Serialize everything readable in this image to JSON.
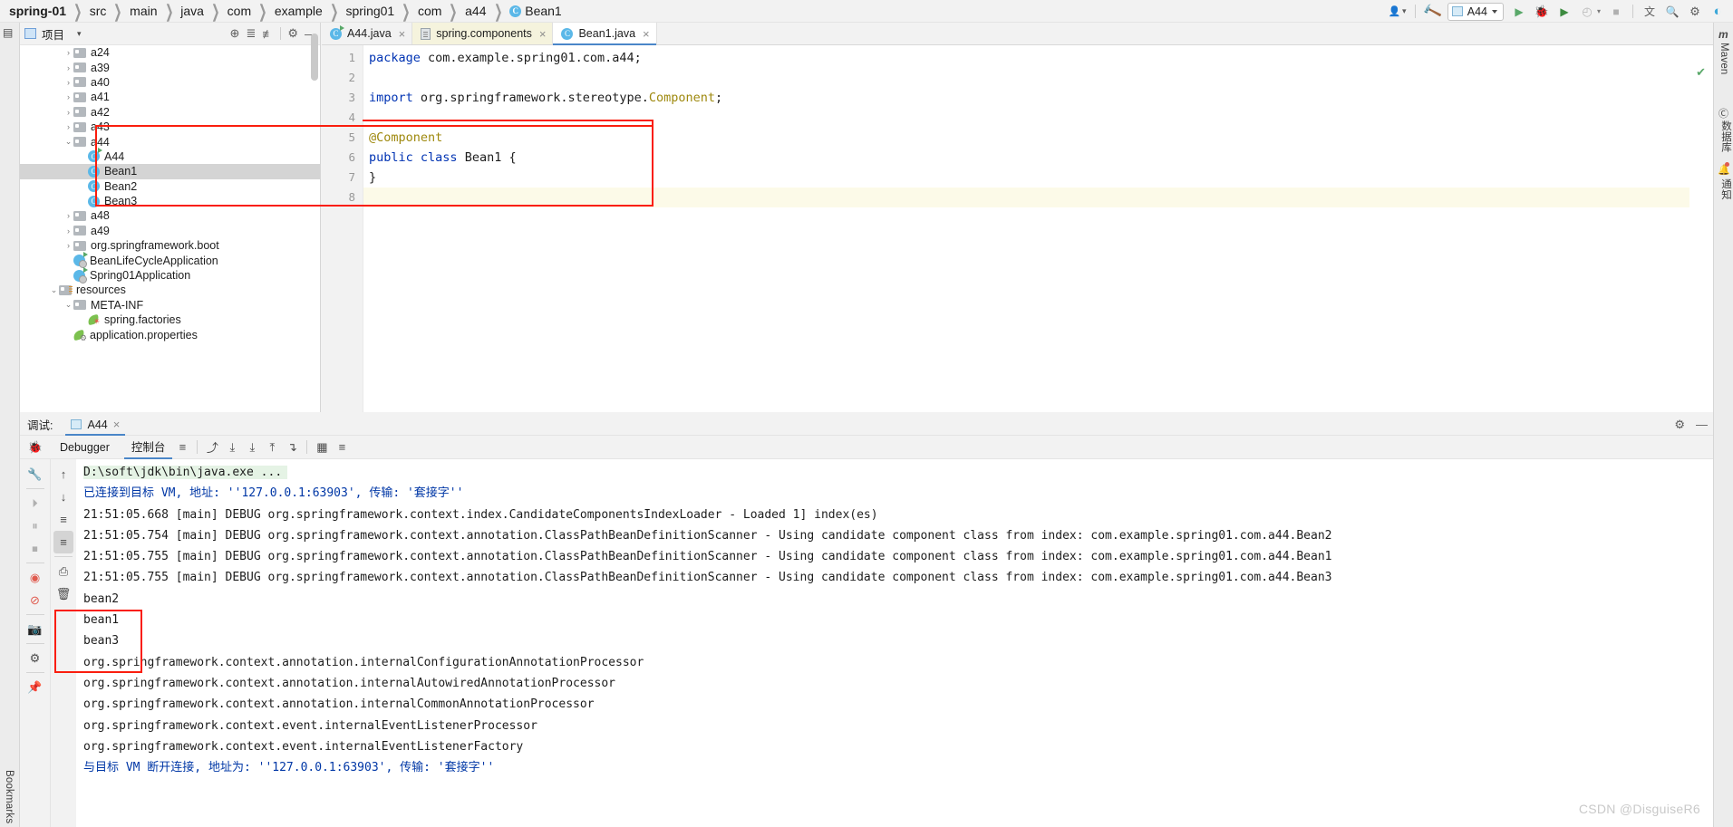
{
  "breadcrumb": {
    "items": [
      "spring-01",
      "src",
      "main",
      "java",
      "com",
      "example",
      "spring01",
      "com",
      "a44"
    ],
    "last_class": "Bean1",
    "class_icon": "C",
    "separator": "❯"
  },
  "toolbar": {
    "user_icon": "👤",
    "user_caret": "▾",
    "build_icon": "🔨",
    "run_config": "A44",
    "run_icon": "▶",
    "debug_icon": "🐞",
    "run_coverage_icon": "▶",
    "profile_icon": "◴",
    "profile_caret": "▾",
    "stop_icon": "■",
    "translate_icon": "文",
    "search_icon": "🔍",
    "settings_icon": "⚙",
    "ide_icon": "◐"
  },
  "left_strip": {
    "project_icon": "▤",
    "bookmarks_label": "Bookmarks"
  },
  "right_strip": {
    "maven_label": "Maven",
    "maven_icon": "m",
    "database_label": "数据库",
    "database_icon": "Ⓒ",
    "notifications_label": "通知",
    "notifications_icon": "🔔"
  },
  "project_panel": {
    "title": "项目",
    "caret": "▾",
    "header_icons": {
      "locate": "⊕",
      "expand_all": "≣",
      "collapse_all": "≢",
      "settings": "⚙",
      "hide": "—"
    },
    "tree": [
      {
        "label": "a24",
        "type": "folder",
        "indent": 3,
        "arrow": "›",
        "selected": false
      },
      {
        "label": "a39",
        "type": "folder",
        "indent": 3,
        "arrow": "›",
        "selected": false
      },
      {
        "label": "a40",
        "type": "folder",
        "indent": 3,
        "arrow": "›",
        "selected": false
      },
      {
        "label": "a41",
        "type": "folder",
        "indent": 3,
        "arrow": "›",
        "selected": false
      },
      {
        "label": "a42",
        "type": "folder",
        "indent": 3,
        "arrow": "›",
        "selected": false
      },
      {
        "label": "a43",
        "type": "folder",
        "indent": 3,
        "arrow": "›",
        "selected": false
      },
      {
        "label": "a44",
        "type": "folder",
        "indent": 3,
        "arrow": "⌄",
        "selected": false
      },
      {
        "label": "A44",
        "type": "class-run",
        "indent": 4,
        "arrow": "",
        "selected": false
      },
      {
        "label": "Bean1",
        "type": "class",
        "indent": 4,
        "arrow": "",
        "selected": true
      },
      {
        "label": "Bean2",
        "type": "class",
        "indent": 4,
        "arrow": "",
        "selected": false
      },
      {
        "label": "Bean3",
        "type": "class",
        "indent": 4,
        "arrow": "",
        "selected": false
      },
      {
        "label": "a48",
        "type": "folder",
        "indent": 3,
        "arrow": "›",
        "selected": false
      },
      {
        "label": "a49",
        "type": "folder",
        "indent": 3,
        "arrow": "›",
        "selected": false
      },
      {
        "label": "org.springframework.boot",
        "type": "folder",
        "indent": 3,
        "arrow": "›",
        "selected": false
      },
      {
        "label": "BeanLifeCycleApplication",
        "type": "app",
        "indent": 3,
        "arrow": "",
        "selected": false
      },
      {
        "label": "Spring01Application",
        "type": "app",
        "indent": 3,
        "arrow": "",
        "selected": false
      },
      {
        "label": "resources",
        "type": "folder-res",
        "indent": 2,
        "arrow": "⌄",
        "selected": false
      },
      {
        "label": "META-INF",
        "type": "folder",
        "indent": 3,
        "arrow": "⌄",
        "selected": false
      },
      {
        "label": "spring.factories",
        "type": "leaf-star",
        "indent": 4,
        "arrow": "",
        "selected": false
      },
      {
        "label": "application.properties",
        "type": "leaf-gear",
        "indent": 3,
        "arrow": "",
        "selected": false
      }
    ]
  },
  "editor": {
    "tabs": [
      {
        "label": "A44.java",
        "icon": "class-run",
        "active": false,
        "yellow": false
      },
      {
        "label": "spring.components",
        "icon": "file",
        "active": false,
        "yellow": true
      },
      {
        "label": "Bean1.java",
        "icon": "class",
        "active": true,
        "yellow": false
      }
    ],
    "close_glyph": "×",
    "line_numbers": [
      "1",
      "2",
      "3",
      "4",
      "5",
      "6",
      "7",
      "8"
    ],
    "lines": [
      {
        "parts": [
          {
            "t": "package ",
            "c": "kw"
          },
          {
            "t": "com.example.spring01.com.a44;",
            "c": ""
          }
        ]
      },
      {
        "parts": []
      },
      {
        "parts": [
          {
            "t": "import ",
            "c": "kw"
          },
          {
            "t": "org.springframework.stereotype.",
            "c": ""
          },
          {
            "t": "Component",
            "c": "ann"
          },
          {
            "t": ";",
            "c": ""
          }
        ]
      },
      {
        "parts": []
      },
      {
        "parts": [
          {
            "t": "@Component",
            "c": "ann"
          }
        ]
      },
      {
        "parts": [
          {
            "t": "public ",
            "c": "kw"
          },
          {
            "t": "class ",
            "c": "kw"
          },
          {
            "t": "Bean1 {",
            "c": ""
          }
        ]
      },
      {
        "parts": [
          {
            "t": "}",
            "c": ""
          }
        ]
      },
      {
        "parts": []
      }
    ],
    "ok_check": "✔"
  },
  "debug": {
    "title": "调试:",
    "session_tab": "A44",
    "session_close": "×",
    "settings_icon": "⚙",
    "minimize_icon": "—",
    "bug_icon": "🐞",
    "tabs": [
      {
        "label": "Debugger",
        "active": false
      },
      {
        "label": "控制台",
        "active": true
      }
    ],
    "toolbar_icons": [
      "≡",
      "⤴",
      "⤓",
      "⤓",
      "⤒",
      "↴",
      "▦",
      "≡"
    ],
    "left_tools": [
      "🔧",
      "⏵",
      "⏸",
      "⏹",
      "◉",
      "⊘",
      "📷",
      "⚙",
      "📌"
    ],
    "left_tools2": [
      "↑",
      "↓",
      "≡",
      "≡",
      "⎙",
      "🗑"
    ],
    "console_lines": [
      {
        "text": "D:\\soft\\jdk\\bin\\java.exe ...",
        "style": "green"
      },
      {
        "text": "已连接到目标 VM, 地址: ''127.0.0.1:63903', 传输: '套接字''",
        "style": "blue"
      },
      {
        "text": "21:51:05.668 [main] DEBUG org.springframework.context.index.CandidateComponentsIndexLoader - Loaded 1] index(es)",
        "style": "plain"
      },
      {
        "text": "21:51:05.754 [main] DEBUG org.springframework.context.annotation.ClassPathBeanDefinitionScanner - Using candidate component class from index: com.example.spring01.com.a44.Bean2",
        "style": "plain"
      },
      {
        "text": "21:51:05.755 [main] DEBUG org.springframework.context.annotation.ClassPathBeanDefinitionScanner - Using candidate component class from index: com.example.spring01.com.a44.Bean1",
        "style": "plain"
      },
      {
        "text": "21:51:05.755 [main] DEBUG org.springframework.context.annotation.ClassPathBeanDefinitionScanner - Using candidate component class from index: com.example.spring01.com.a44.Bean3",
        "style": "plain"
      },
      {
        "text": "bean2",
        "style": "plain"
      },
      {
        "text": "bean1",
        "style": "plain"
      },
      {
        "text": "bean3",
        "style": "plain"
      },
      {
        "text": "org.springframework.context.annotation.internalConfigurationAnnotationProcessor",
        "style": "plain"
      },
      {
        "text": "org.springframework.context.annotation.internalAutowiredAnnotationProcessor",
        "style": "plain"
      },
      {
        "text": "org.springframework.context.annotation.internalCommonAnnotationProcessor",
        "style": "plain"
      },
      {
        "text": "org.springframework.context.event.internalEventListenerProcessor",
        "style": "plain"
      },
      {
        "text": "org.springframework.context.event.internalEventListenerFactory",
        "style": "plain"
      },
      {
        "text": "与目标 VM 断开连接, 地址为: ''127.0.0.1:63903', 传输: '套接字''",
        "style": "blue"
      }
    ]
  },
  "watermark": "CSDN @DisguiseR6",
  "colors": {
    "accent": "#4a86c8",
    "annotation_red": "#fa1e0e",
    "keyword_blue": "#0033b3",
    "annotation_gold": "#9e880d",
    "green": "#59a869",
    "selection_gray": "#d4d4d4"
  }
}
